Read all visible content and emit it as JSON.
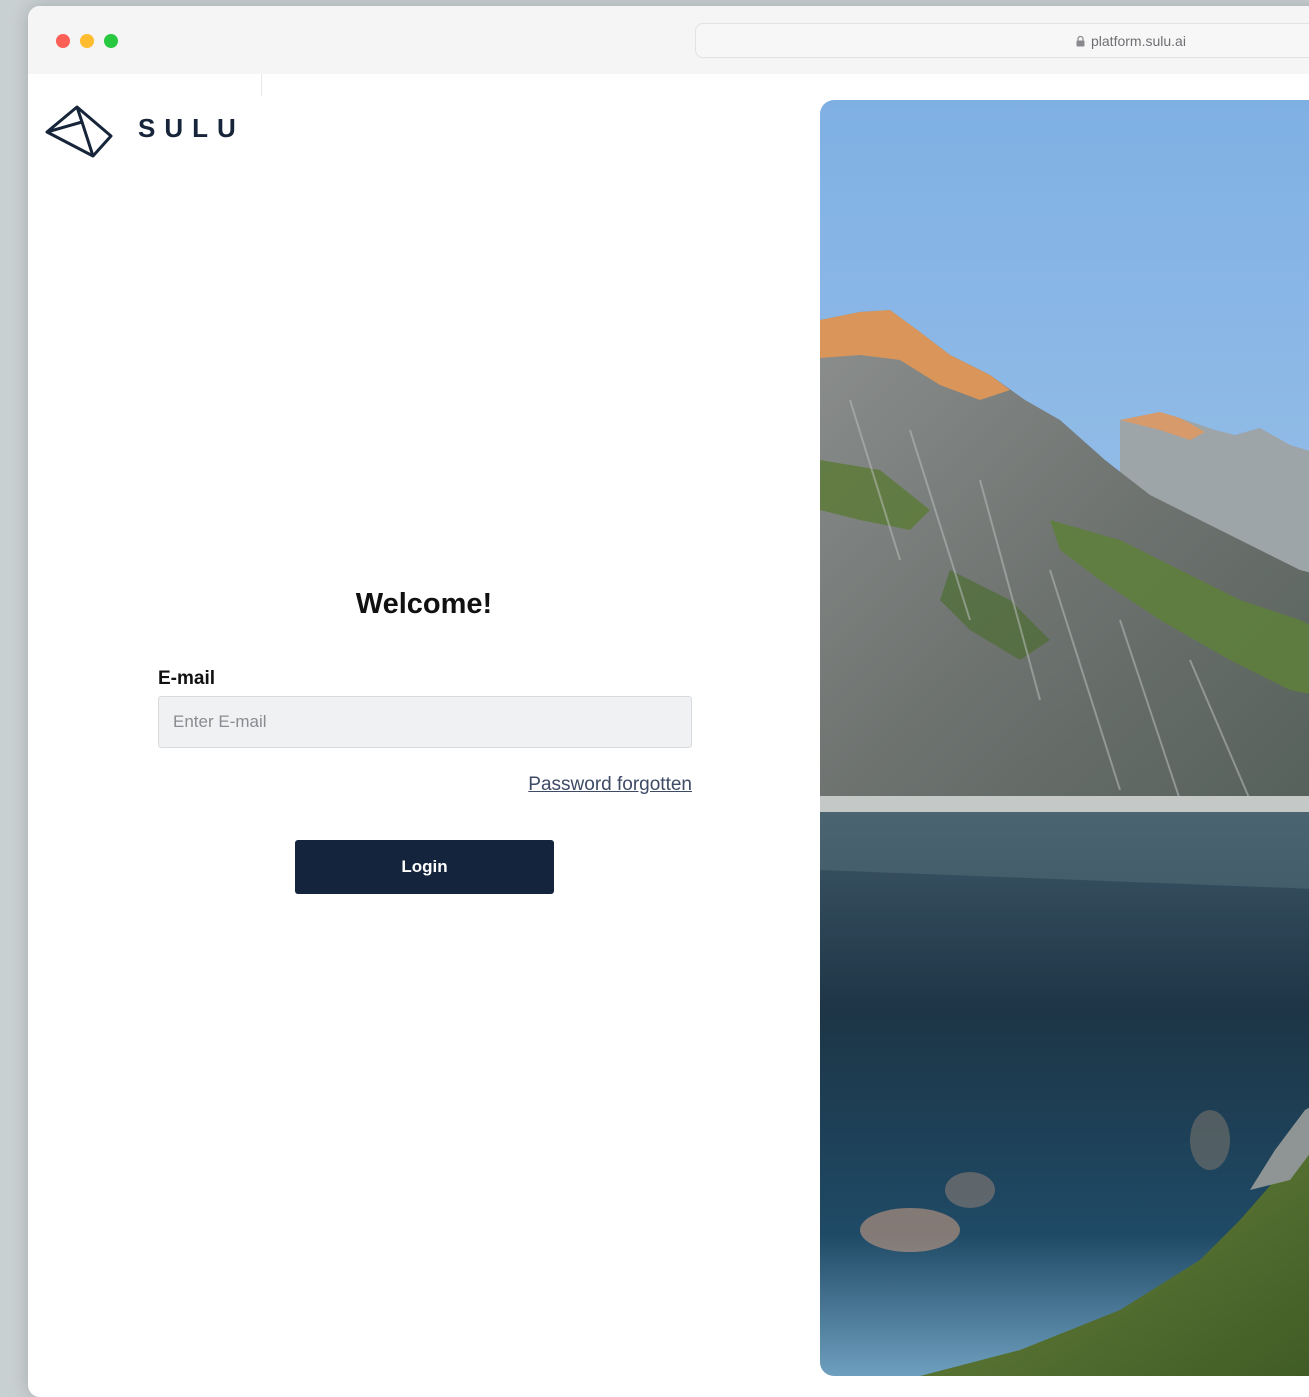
{
  "browser": {
    "url": "platform.sulu.ai"
  },
  "brand": {
    "name": "SULU"
  },
  "login": {
    "title": "Welcome!",
    "email_label": "E-mail",
    "email_placeholder": "Enter E-mail",
    "email_value": "",
    "forgot_label": "Password forgotten",
    "login_label": "Login"
  },
  "hero_image": {
    "icon": "mountain-lake-photo"
  },
  "colors": {
    "brand_navy": "#14243d",
    "link": "#3e4a66",
    "input_bg": "#eff1f3"
  }
}
